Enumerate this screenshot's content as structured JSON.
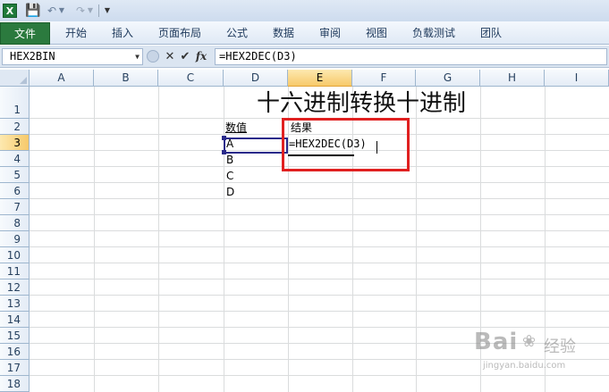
{
  "quick_access": {
    "app_icon": "X",
    "save_icon": "save-icon",
    "undo_icon": "undo-icon",
    "redo_icon": "redo-icon"
  },
  "ribbon": {
    "file_tab": "文件",
    "tabs": [
      "开始",
      "插入",
      "页面布局",
      "公式",
      "数据",
      "审阅",
      "视图",
      "负载测试",
      "团队"
    ]
  },
  "formula_bar": {
    "name_box": "HEX2BIN",
    "fx_label": "fx",
    "formula": "=HEX2DEC(D3)"
  },
  "columns": [
    "A",
    "B",
    "C",
    "D",
    "E",
    "F",
    "G",
    "H",
    "I"
  ],
  "selected_column": "E",
  "rows": [
    "1",
    "2",
    "3",
    "4",
    "5",
    "6",
    "7",
    "8",
    "9",
    "10",
    "11",
    "12",
    "13",
    "14",
    "15",
    "16",
    "17",
    "18"
  ],
  "selected_row": "3",
  "cells": {
    "title": "十六进制转换十进制",
    "d2": "数值",
    "e2": "结果",
    "d3": "A",
    "d4": "B",
    "d5": "C",
    "d6": "D",
    "e3": "=HEX2DEC(D3)"
  },
  "watermark": {
    "logo": "Bai",
    "suffix": "经验",
    "sub": "jingyan.baidu.com"
  },
  "colors": {
    "file_tab": "#2b7a3e",
    "highlight": "#e02020",
    "selected_header": "#f7c96a"
  }
}
